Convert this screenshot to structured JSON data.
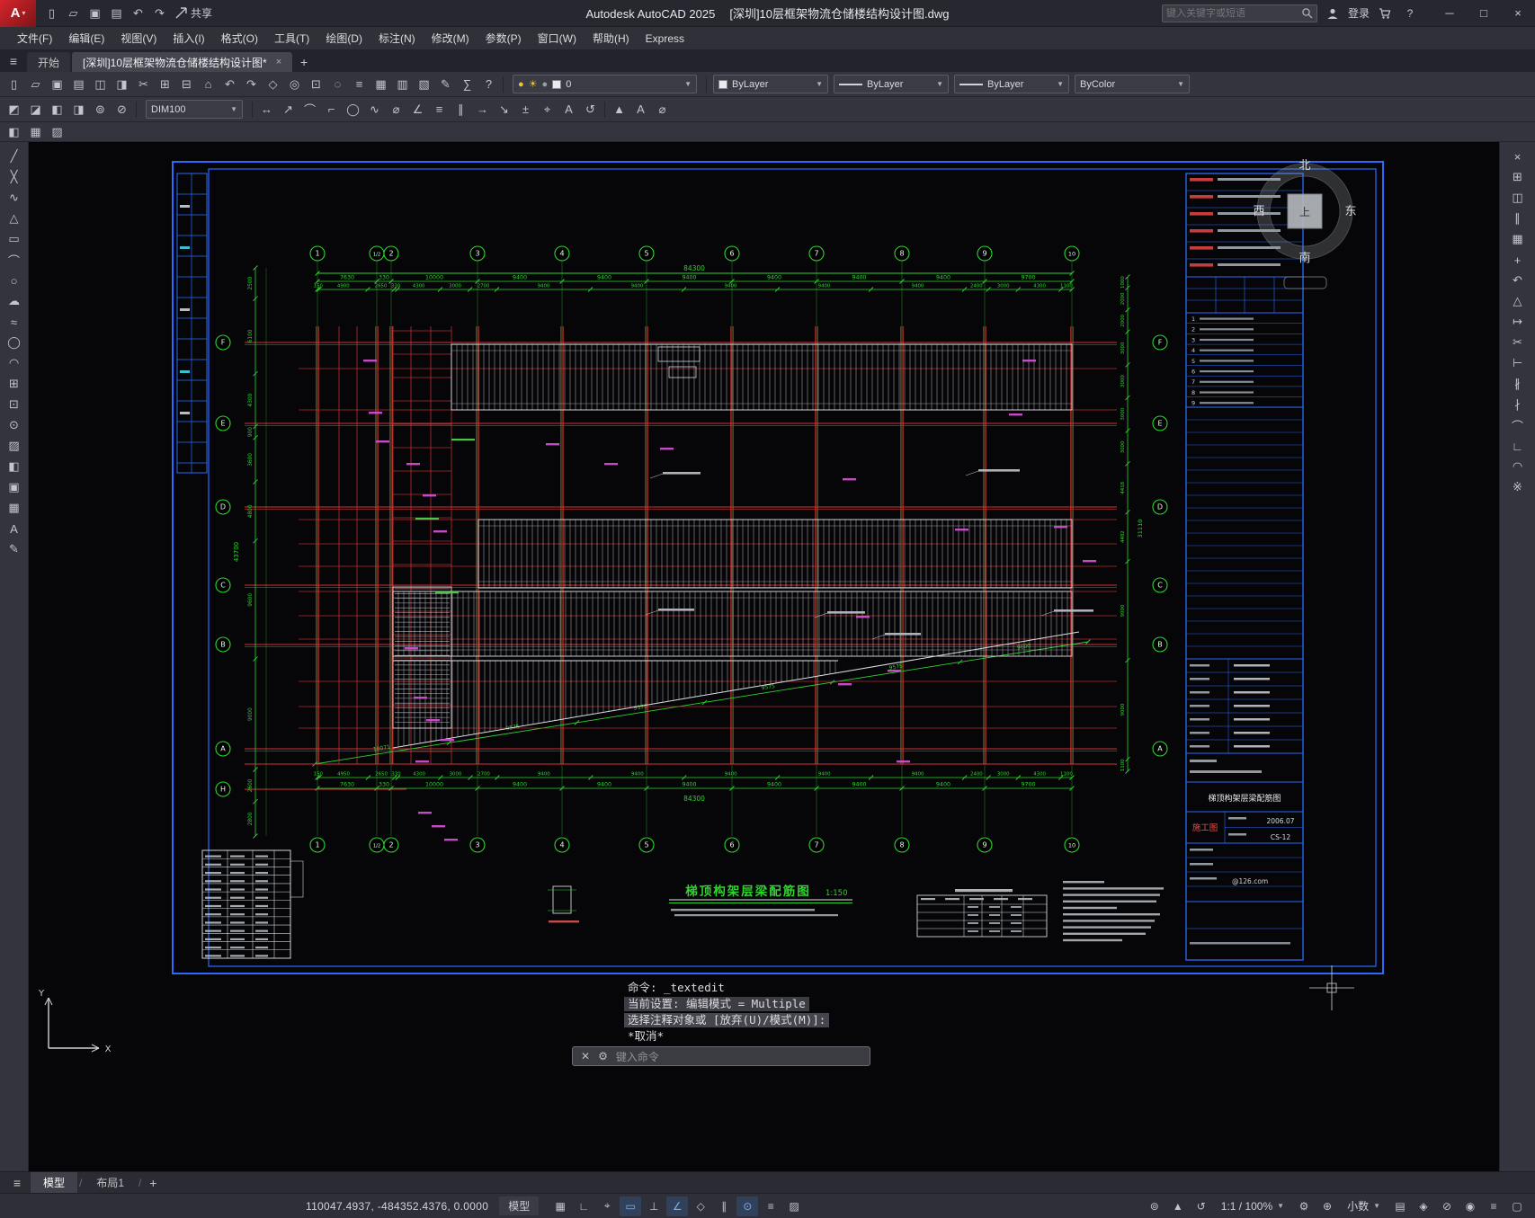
{
  "colors": {
    "sheet_blue": "#2a6bff",
    "grid_red": "#d03434",
    "dim_green": "#2fd42f",
    "beam_white": "#ced3d9",
    "magenta": "#cf4fcf"
  },
  "titlebar": {
    "logo_letter": "A",
    "share_label": "共享",
    "app_title": "Autodesk AutoCAD 2025",
    "doc_title": "[深圳]10层框架物流仓储楼结构设计图.dwg",
    "search_placeholder": "键入关键字或短语",
    "signin_label": "登录",
    "help_glyph": "?",
    "window_controls": [
      {
        "name": "minimize",
        "glyph": "─"
      },
      {
        "name": "maximize",
        "glyph": "□"
      },
      {
        "name": "close",
        "glyph": "×"
      }
    ],
    "qat_icons": [
      {
        "name": "new-drawing",
        "glyph": "▯"
      },
      {
        "name": "open-file",
        "glyph": "▱"
      },
      {
        "name": "save-file",
        "glyph": "▣"
      },
      {
        "name": "print",
        "glyph": "▤"
      },
      {
        "name": "undo",
        "glyph": "↶"
      },
      {
        "name": "redo",
        "glyph": "↷"
      }
    ]
  },
  "menubar": {
    "items": [
      "文件(F)",
      "编辑(E)",
      "视图(V)",
      "插入(I)",
      "格式(O)",
      "工具(T)",
      "绘图(D)",
      "标注(N)",
      "修改(M)",
      "参数(P)",
      "窗口(W)",
      "帮助(H)",
      "Express"
    ]
  },
  "doc_tabs": {
    "hamburger_glyph": "≡",
    "start_label": "开始",
    "active_label": "[深圳]10层框架物流仓储楼结构设计图*",
    "close_glyph": "×",
    "new_tab_glyph": "+"
  },
  "toolbar": {
    "layer_value": "0",
    "dim_style_value": "DIM100",
    "color_value": "ByLayer",
    "linetype_value": "ByLayer",
    "lineweight_value": "ByLayer",
    "plotstyle_value": "ByColor",
    "row1_icons": [
      {
        "name": "new",
        "glyph": "▯"
      },
      {
        "name": "open",
        "glyph": "▱"
      },
      {
        "name": "save",
        "glyph": "▣"
      },
      {
        "name": "plot",
        "glyph": "▤"
      },
      {
        "name": "plot-preview",
        "glyph": "◫"
      },
      {
        "name": "publish",
        "glyph": "◨"
      },
      {
        "name": "cut",
        "glyph": "✂"
      },
      {
        "name": "copy-clip",
        "glyph": "⊞"
      },
      {
        "name": "paste",
        "glyph": "⊟"
      },
      {
        "name": "match-properties",
        "glyph": "⌂"
      },
      {
        "name": "undo",
        "glyph": "↶"
      },
      {
        "name": "redo",
        "glyph": "↷"
      },
      {
        "name": "pan",
        "glyph": "◇"
      },
      {
        "name": "zoom-realtime",
        "glyph": "◎"
      },
      {
        "name": "zoom-window",
        "glyph": "⊡"
      },
      {
        "name": "zoom-previous",
        "glyph": "◌"
      },
      {
        "name": "properties",
        "glyph": "≡"
      },
      {
        "name": "designcenter",
        "glyph": "▦"
      },
      {
        "name": "tool-palettes",
        "glyph": "▥"
      },
      {
        "name": "sheet-set-manager",
        "glyph": "▧"
      },
      {
        "name": "markup",
        "glyph": "✎"
      },
      {
        "name": "quick-calc",
        "glyph": "∑"
      },
      {
        "name": "help",
        "glyph": "?"
      }
    ],
    "row2_left_icons": [
      {
        "name": "draworder-front",
        "glyph": "◩"
      },
      {
        "name": "draworder-back",
        "glyph": "◪"
      },
      {
        "name": "draworder-above",
        "glyph": "◧"
      },
      {
        "name": "draworder-below",
        "glyph": "◨"
      },
      {
        "name": "isolate",
        "glyph": "⊚"
      },
      {
        "name": "hide-objects",
        "glyph": "⊘"
      }
    ],
    "row2_dim_icons": [
      {
        "name": "dim-linear",
        "glyph": "↔"
      },
      {
        "name": "dim-aligned",
        "glyph": "↗"
      },
      {
        "name": "dim-arc-length",
        "glyph": "⌒"
      },
      {
        "name": "dim-ordinate",
        "glyph": "⌐"
      },
      {
        "name": "dim-radius",
        "glyph": "◯"
      },
      {
        "name": "dim-jogged",
        "glyph": "∿"
      },
      {
        "name": "dim-diameter",
        "glyph": "⌀"
      },
      {
        "name": "dim-angular",
        "glyph": "∠"
      },
      {
        "name": "quick-dim",
        "glyph": "≡"
      },
      {
        "name": "dim-baseline",
        "glyph": "∥"
      },
      {
        "name": "dim-continue",
        "glyph": "→"
      },
      {
        "name": "multileader",
        "glyph": "↘"
      },
      {
        "name": "tolerance",
        "glyph": "±"
      },
      {
        "name": "center-mark",
        "glyph": "⌖"
      },
      {
        "name": "dim-text-edit",
        "glyph": "A"
      },
      {
        "name": "dim-update",
        "glyph": "↺"
      }
    ],
    "row2_right_icons": [
      {
        "name": "annotation",
        "glyph": "▲"
      },
      {
        "name": "text-style",
        "glyph": "A"
      },
      {
        "name": "dim-style-manager",
        "glyph": "⌀"
      }
    ],
    "row3_icons": [
      {
        "name": "layer-previous",
        "glyph": "◧"
      },
      {
        "name": "layer-states",
        "glyph": "▦"
      },
      {
        "name": "layer-isolate",
        "glyph": "▨"
      }
    ]
  },
  "left_tools": [
    {
      "name": "line",
      "glyph": "╱"
    },
    {
      "name": "construction-line",
      "glyph": "╳"
    },
    {
      "name": "polyline",
      "glyph": "∿"
    },
    {
      "name": "polygon",
      "glyph": "△"
    },
    {
      "name": "rectangle",
      "glyph": "▭"
    },
    {
      "name": "arc",
      "glyph": "⌒"
    },
    {
      "name": "circle",
      "glyph": "○"
    },
    {
      "name": "revision-cloud",
      "glyph": "☁"
    },
    {
      "name": "spline",
      "glyph": "≈"
    },
    {
      "name": "ellipse",
      "glyph": "◯"
    },
    {
      "name": "ellipse-arc",
      "glyph": "◠"
    },
    {
      "name": "insert-block",
      "glyph": "⊞"
    },
    {
      "name": "make-block",
      "glyph": "⊡"
    },
    {
      "name": "point",
      "glyph": "⊙"
    },
    {
      "name": "hatch",
      "glyph": "▨"
    },
    {
      "name": "gradient",
      "glyph": "◧"
    },
    {
      "name": "region",
      "glyph": "▣"
    },
    {
      "name": "table",
      "glyph": "▦"
    },
    {
      "name": "multiline-text",
      "glyph": "A"
    },
    {
      "name": "add-selected",
      "glyph": "✎"
    }
  ],
  "right_tools": [
    {
      "name": "erase",
      "glyph": "×"
    },
    {
      "name": "copy",
      "glyph": "⊞"
    },
    {
      "name": "mirror",
      "glyph": "◫"
    },
    {
      "name": "offset",
      "glyph": "∥"
    },
    {
      "name": "array",
      "glyph": "▦"
    },
    {
      "name": "move",
      "glyph": "+"
    },
    {
      "name": "rotate",
      "glyph": "↶"
    },
    {
      "name": "scale",
      "glyph": "△"
    },
    {
      "name": "stretch",
      "glyph": "↦"
    },
    {
      "name": "trim",
      "glyph": "✂"
    },
    {
      "name": "extend",
      "glyph": "⊢"
    },
    {
      "name": "break-at-point",
      "glyph": "∦"
    },
    {
      "name": "break",
      "glyph": "∤"
    },
    {
      "name": "join",
      "glyph": "⌒"
    },
    {
      "name": "chamfer",
      "glyph": "∟"
    },
    {
      "name": "fillet",
      "glyph": "◠"
    },
    {
      "name": "explode",
      "glyph": "※"
    }
  ],
  "drawing": {
    "title": "梯顶构架层梁配筋图",
    "scale": "1:150",
    "viewcube": {
      "north": "北",
      "south": "南",
      "west": "西",
      "east": "东",
      "top": "上"
    },
    "ucs": {
      "x": "X",
      "y": "Y"
    },
    "grid_cols": [
      "1",
      "1/2",
      "2",
      "3",
      "4",
      "5",
      "6",
      "7",
      "8",
      "9",
      "10"
    ],
    "grid_rows": [
      "F",
      "E",
      "D",
      "C",
      "B",
      "A"
    ],
    "grid_row_extra": "H",
    "dims_top_total": "84300",
    "dims_top": [
      "7630",
      "330",
      "10000",
      "9400",
      "9400",
      "9400",
      "9400",
      "9400",
      "9400",
      "9700"
    ],
    "dims_top2": [
      "150",
      "4900",
      "2650",
      "330",
      "4300",
      "3000",
      "2700",
      "9400",
      "9400",
      "9400",
      "9400",
      "9400",
      "2400",
      "3000",
      "4300",
      "1100"
    ],
    "dims_bottom_total": "84300",
    "dims_bottom": [
      "7630",
      "330",
      "10000",
      "9400",
      "9400",
      "9400",
      "9400",
      "9400",
      "9400",
      "9700"
    ],
    "dims_bottom2": [
      "150",
      "4950",
      "2650",
      "330",
      "4300",
      "3000",
      "2700",
      "9400",
      "9400",
      "9400",
      "9400",
      "9400",
      "2400",
      "3000",
      "4300",
      "1100"
    ],
    "dims_left": [
      "2500",
      "6100",
      "4300",
      "900",
      "3600",
      "4800",
      "9600",
      "9000",
      "2600",
      "2800"
    ],
    "dims_left_total": "43700",
    "dims_right": [
      "1000",
      "2000",
      "2000",
      "3000",
      "3000",
      "3000",
      "3000",
      "4418",
      "4482",
      "9000",
      "9000",
      "1100"
    ],
    "dims_right_total": "31110",
    "diag_dims": [
      "10071",
      "9575",
      "9575",
      "9575",
      "9575",
      "9600"
    ],
    "titleblock": {
      "stage": "施工图",
      "date": "2006.07",
      "number": "CS-12",
      "email": "@126.com",
      "title": "梯顶构架层梁配筋图",
      "revision_rows": [
        "1",
        "2",
        "3",
        "4",
        "5",
        "6",
        "7",
        "8",
        "9"
      ]
    }
  },
  "command": {
    "lines": [
      "命令: _textedit",
      "当前设置: 编辑模式 = Multiple",
      "选择注释对象或 [放弃(U)/模式(M)]:",
      "*取消*"
    ],
    "input_placeholder": "键入命令",
    "cancel_glyph": "✕",
    "customize_glyph": "⚙"
  },
  "layout_tabs": {
    "hamburger_glyph": "≡",
    "model": "模型",
    "layout1": "布局1",
    "new_glyph": "+",
    "slash": "/"
  },
  "statusbar": {
    "coords": "110047.4937, -484352.4376, 0.0000",
    "model": "模型",
    "scale": "1:1 / 100%",
    "units": "小数",
    "left_icons": [
      {
        "name": "grid-display",
        "glyph": "▦"
      },
      {
        "name": "snap-mode",
        "glyph": "∟"
      },
      {
        "name": "infer-constraints",
        "glyph": "⌖"
      },
      {
        "name": "dynamic-input",
        "glyph": "▭",
        "active": true
      },
      {
        "name": "ortho-mode",
        "glyph": "⊥"
      },
      {
        "name": "polar-tracking",
        "glyph": "∠",
        "active": true
      },
      {
        "name": "isodraft",
        "glyph": "◇"
      },
      {
        "name": "object-snap-tracking",
        "glyph": "∥"
      },
      {
        "name": "object-snap",
        "glyph": "⊙",
        "active": true
      },
      {
        "name": "lineweight-display",
        "glyph": "≡"
      },
      {
        "name": "transparency",
        "glyph": "▨"
      }
    ],
    "right_icons_1": [
      {
        "name": "selection-cycling",
        "glyph": "⊚"
      },
      {
        "name": "annotation-visibility",
        "glyph": "▲"
      },
      {
        "name": "autoscale",
        "glyph": "↺"
      }
    ],
    "right_icons_2": [
      {
        "name": "workspace-switching",
        "glyph": "⚙"
      },
      {
        "name": "annotation-monitor",
        "glyph": "⊕"
      }
    ],
    "right_icons_3": [
      {
        "name": "quick-properties",
        "glyph": "▤"
      },
      {
        "name": "lock-ui",
        "glyph": "◈"
      },
      {
        "name": "isolate-objects",
        "glyph": "⊘"
      },
      {
        "name": "graphics-performance",
        "glyph": "◉"
      },
      {
        "name": "customization",
        "glyph": "≡"
      },
      {
        "name": "clean-screen",
        "glyph": "▢"
      }
    ]
  }
}
